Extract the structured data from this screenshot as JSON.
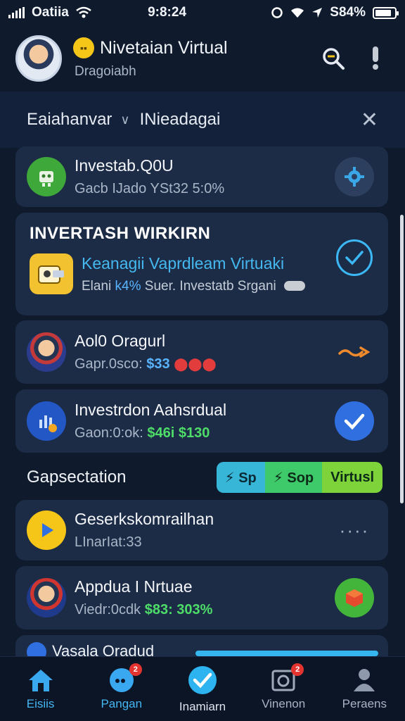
{
  "status_bar": {
    "carrier": "Oatiia",
    "time": "9:8:24",
    "battery_text": "S84%",
    "battery_level": 0.84
  },
  "header": {
    "title": "Nivetaian Virtual",
    "subtitle": "Dragoiabh",
    "coin_symbol": "▪▪"
  },
  "filter": {
    "left_label": "Eaiahanvar",
    "right_label": "INieadagai"
  },
  "cards": {
    "investab": {
      "title": "Investab.Q0U",
      "subtitle": "Gacb IJado YSt32 5:0%"
    },
    "highlight": {
      "heading": "INVERTASH WIRKIRN",
      "title": "Keanagii Vaprdleam Virtuaki",
      "subtitle_prefix": "Elani",
      "subtitle_accent": "k4%",
      "subtitle_rest": "Suer. Investatb Srgani"
    },
    "aqlo": {
      "title": "Aol0 Oragurl",
      "subtitle_prefix": "Gapr.0sco:",
      "subtitle_value": "$33"
    },
    "investrdon": {
      "title": "Investrdon Aahsrdual",
      "subtitle_prefix": "Gaon:0:ok:",
      "subtitle_value": "$46i $130"
    }
  },
  "section": {
    "title": "Gapsectation",
    "pills": [
      {
        "label": "⚡ Sp",
        "color": "#38b6d8"
      },
      {
        "label": "⚡ Sop",
        "color": "#3ec96b"
      },
      {
        "label": "Virtusl",
        "color": "#7ed33a"
      }
    ]
  },
  "list": {
    "gesrks": {
      "title": "Geserkskomrailhan",
      "subtitle": "LInarIat:33"
    },
    "appdua": {
      "title": "Appdua I Nrtuae",
      "subtitle_prefix": "Viedr:0cdk",
      "subtitle_value": "$83: 303%"
    },
    "peek": {
      "title": "Vasala Oradud"
    }
  },
  "bottom_nav": [
    {
      "label": "Eisiis",
      "icon": "home-icon",
      "badge": ""
    },
    {
      "label": "Pangan",
      "icon": "chat-bubble-icon",
      "badge": "2"
    },
    {
      "label": "Inamiarn",
      "icon": "check-circle-icon",
      "badge": ""
    },
    {
      "label": "Vinenon",
      "icon": "camera-icon",
      "badge": "2"
    },
    {
      "label": "Peraens",
      "icon": "person-icon",
      "badge": ""
    }
  ],
  "colors": {
    "background": "#0f1b2d",
    "card": "#1c2c46",
    "accent_blue": "#45b6f2",
    "accent_green": "#4ddd68"
  }
}
